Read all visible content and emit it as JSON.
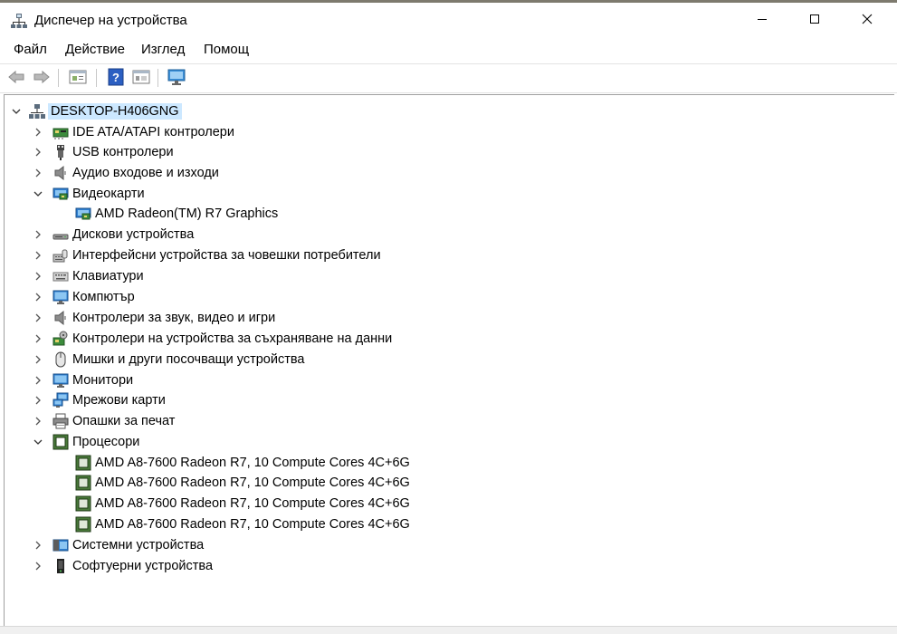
{
  "window": {
    "title": "Диспечер на устройства",
    "controls": [
      "minimize",
      "maximize",
      "close"
    ]
  },
  "menu": [
    "Файл",
    "Действие",
    "Изглед",
    "Помощ"
  ],
  "toolbar": [
    "back-arrow-icon",
    "forward-arrow-icon",
    "properties-icon",
    "help-icon",
    "view-icon",
    "monitor-scan-icon"
  ],
  "tree": {
    "root": {
      "label": "DESKTOP-H406GNG",
      "expanded": true,
      "selected": true
    },
    "categories": [
      {
        "label": "IDE ATA/ATAPI контролери",
        "icon": "ide-controller-icon",
        "expanded": false
      },
      {
        "label": "USB контролери",
        "icon": "usb-icon",
        "expanded": false
      },
      {
        "label": "Аудио входове и изходи",
        "icon": "speaker-icon",
        "expanded": false
      },
      {
        "label": "Видеокарти",
        "icon": "display-adapter-icon",
        "expanded": true,
        "children": [
          "AMD Radeon(TM) R7 Graphics"
        ]
      },
      {
        "label": "Дискови устройства",
        "icon": "disk-drive-icon",
        "expanded": false
      },
      {
        "label": "Интерфейсни устройства за човешки потребители",
        "icon": "hid-icon",
        "expanded": false
      },
      {
        "label": "Клавиатури",
        "icon": "keyboard-icon",
        "expanded": false
      },
      {
        "label": "Компютър",
        "icon": "computer-icon",
        "expanded": false
      },
      {
        "label": "Контролери за звук, видео и игри",
        "icon": "sound-controller-icon",
        "expanded": false
      },
      {
        "label": "Контролери на устройства за съхраняване на данни",
        "icon": "storage-controller-icon",
        "expanded": false
      },
      {
        "label": "Мишки и други посочващи устройства",
        "icon": "mouse-icon",
        "expanded": false
      },
      {
        "label": "Монитори",
        "icon": "monitor-icon",
        "expanded": false
      },
      {
        "label": "Мрежови карти",
        "icon": "network-adapter-icon",
        "expanded": false
      },
      {
        "label": "Опашки за печат",
        "icon": "printer-icon",
        "expanded": false
      },
      {
        "label": "Процесори",
        "icon": "processor-icon",
        "expanded": true,
        "children": [
          "AMD A8-7600 Radeon R7, 10 Compute Cores 4C+6G",
          "AMD A8-7600 Radeon R7, 10 Compute Cores 4C+6G",
          "AMD A8-7600 Radeon R7, 10 Compute Cores 4C+6G",
          "AMD A8-7600 Radeon R7, 10 Compute Cores 4C+6G"
        ]
      },
      {
        "label": "Системни устройства",
        "icon": "system-devices-icon",
        "expanded": false
      },
      {
        "label": "Софтуерни устройства",
        "icon": "software-device-icon",
        "expanded": false
      }
    ]
  }
}
